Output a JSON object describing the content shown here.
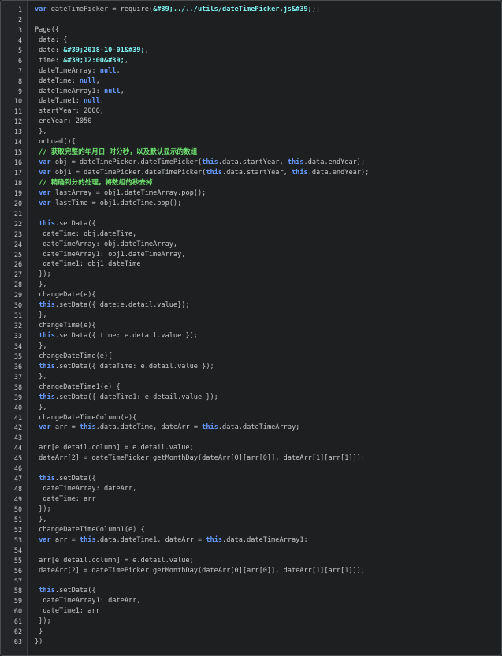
{
  "colors": {
    "background": "#1d1f21",
    "gutter": "#232528",
    "text": "#c5c8c6",
    "keyword": "#6699ff",
    "string": "#7ff2f0",
    "comment": "#6ee36e"
  },
  "lines": [
    {
      "n": "1",
      "tokens": [
        {
          "k": "kw",
          "t": "var"
        },
        {
          "k": "plain",
          "t": " dateTimePicker = require("
        },
        {
          "k": "str",
          "t": "&#39;../../utils/dateTimePicker.js&#39;"
        },
        {
          "k": "plain",
          "t": ");"
        }
      ]
    },
    {
      "n": "2",
      "tokens": []
    },
    {
      "n": "3",
      "tokens": [
        {
          "k": "plain",
          "t": "Page({"
        }
      ]
    },
    {
      "n": "4",
      "tokens": [
        {
          "k": "plain",
          "t": " data: {"
        }
      ]
    },
    {
      "n": "5",
      "tokens": [
        {
          "k": "plain",
          "t": " date: "
        },
        {
          "k": "str",
          "t": "&#39;2018-10-01&#39;"
        },
        {
          "k": "plain",
          "t": ","
        }
      ]
    },
    {
      "n": "6",
      "tokens": [
        {
          "k": "plain",
          "t": " time: "
        },
        {
          "k": "str",
          "t": "&#39;12:00&#39;"
        },
        {
          "k": "plain",
          "t": ","
        }
      ]
    },
    {
      "n": "7",
      "tokens": [
        {
          "k": "plain",
          "t": " dateTimeArray: "
        },
        {
          "k": "kw",
          "t": "null"
        },
        {
          "k": "plain",
          "t": ","
        }
      ]
    },
    {
      "n": "8",
      "tokens": [
        {
          "k": "plain",
          "t": " dateTime: "
        },
        {
          "k": "kw",
          "t": "null"
        },
        {
          "k": "plain",
          "t": ","
        }
      ]
    },
    {
      "n": "9",
      "tokens": [
        {
          "k": "plain",
          "t": " dateTimeArray1: "
        },
        {
          "k": "kw",
          "t": "null"
        },
        {
          "k": "plain",
          "t": ","
        }
      ]
    },
    {
      "n": "10",
      "tokens": [
        {
          "k": "plain",
          "t": " dateTime1: "
        },
        {
          "k": "kw",
          "t": "null"
        },
        {
          "k": "plain",
          "t": ","
        }
      ]
    },
    {
      "n": "11",
      "tokens": [
        {
          "k": "plain",
          "t": " startYear: 2000,"
        }
      ]
    },
    {
      "n": "12",
      "tokens": [
        {
          "k": "plain",
          "t": " endYear: 2050"
        }
      ]
    },
    {
      "n": "13",
      "tokens": [
        {
          "k": "plain",
          "t": " },"
        }
      ]
    },
    {
      "n": "14",
      "tokens": [
        {
          "k": "plain",
          "t": " onLoad(){"
        }
      ]
    },
    {
      "n": "15",
      "tokens": [
        {
          "k": "cmt",
          "t": " // 获取完整的年月日 时分秒，以及默认显示的数组"
        }
      ]
    },
    {
      "n": "16",
      "tokens": [
        {
          "k": "plain",
          "t": " "
        },
        {
          "k": "kw",
          "t": "var"
        },
        {
          "k": "plain",
          "t": " obj = dateTimePicker.dateTimePicker("
        },
        {
          "k": "kw",
          "t": "this"
        },
        {
          "k": "plain",
          "t": ".data.startYear, "
        },
        {
          "k": "kw",
          "t": "this"
        },
        {
          "k": "plain",
          "t": ".data.endYear);"
        }
      ]
    },
    {
      "n": "17",
      "tokens": [
        {
          "k": "plain",
          "t": " "
        },
        {
          "k": "kw",
          "t": "var"
        },
        {
          "k": "plain",
          "t": " obj1 = dateTimePicker.dateTimePicker("
        },
        {
          "k": "kw",
          "t": "this"
        },
        {
          "k": "plain",
          "t": ".data.startYear, "
        },
        {
          "k": "kw",
          "t": "this"
        },
        {
          "k": "plain",
          "t": ".data.endYear);"
        }
      ]
    },
    {
      "n": "18",
      "tokens": [
        {
          "k": "cmt",
          "t": " // 精确到分的处理，将数组的秒去掉"
        }
      ]
    },
    {
      "n": "19",
      "tokens": [
        {
          "k": "plain",
          "t": " "
        },
        {
          "k": "kw",
          "t": "var"
        },
        {
          "k": "plain",
          "t": " lastArray = obj1.dateTimeArray.pop();"
        }
      ]
    },
    {
      "n": "20",
      "tokens": [
        {
          "k": "plain",
          "t": " "
        },
        {
          "k": "kw",
          "t": "var"
        },
        {
          "k": "plain",
          "t": " lastTime = obj1.dateTime.pop();"
        }
      ]
    },
    {
      "n": "21",
      "tokens": []
    },
    {
      "n": "22",
      "tokens": [
        {
          "k": "plain",
          "t": " "
        },
        {
          "k": "kw",
          "t": "this"
        },
        {
          "k": "plain",
          "t": ".setData({"
        }
      ]
    },
    {
      "n": "23",
      "tokens": [
        {
          "k": "plain",
          "t": "  dateTime: obj.dateTime,"
        }
      ]
    },
    {
      "n": "24",
      "tokens": [
        {
          "k": "plain",
          "t": "  dateTimeArray: obj.dateTimeArray,"
        }
      ]
    },
    {
      "n": "25",
      "tokens": [
        {
          "k": "plain",
          "t": "  dateTimeArray1: obj1.dateTimeArray,"
        }
      ]
    },
    {
      "n": "26",
      "tokens": [
        {
          "k": "plain",
          "t": "  dateTime1: obj1.dateTime"
        }
      ]
    },
    {
      "n": "27",
      "tokens": [
        {
          "k": "plain",
          "t": " });"
        }
      ]
    },
    {
      "n": "28",
      "tokens": [
        {
          "k": "plain",
          "t": " },"
        }
      ]
    },
    {
      "n": "29",
      "tokens": [
        {
          "k": "plain",
          "t": " changeDate(e){"
        }
      ]
    },
    {
      "n": "30",
      "tokens": [
        {
          "k": "plain",
          "t": " "
        },
        {
          "k": "kw",
          "t": "this"
        },
        {
          "k": "plain",
          "t": ".setData({ date:e.detail.value});"
        }
      ]
    },
    {
      "n": "31",
      "tokens": [
        {
          "k": "plain",
          "t": " },"
        }
      ]
    },
    {
      "n": "32",
      "tokens": [
        {
          "k": "plain",
          "t": " changeTime(e){"
        }
      ]
    },
    {
      "n": "33",
      "tokens": [
        {
          "k": "plain",
          "t": " "
        },
        {
          "k": "kw",
          "t": "this"
        },
        {
          "k": "plain",
          "t": ".setData({ time: e.detail.value });"
        }
      ]
    },
    {
      "n": "34",
      "tokens": [
        {
          "k": "plain",
          "t": " },"
        }
      ]
    },
    {
      "n": "35",
      "tokens": [
        {
          "k": "plain",
          "t": " changeDateTime(e){"
        }
      ]
    },
    {
      "n": "36",
      "tokens": [
        {
          "k": "plain",
          "t": " "
        },
        {
          "k": "kw",
          "t": "this"
        },
        {
          "k": "plain",
          "t": ".setData({ dateTime: e.detail.value });"
        }
      ]
    },
    {
      "n": "37",
      "tokens": [
        {
          "k": "plain",
          "t": " },"
        }
      ]
    },
    {
      "n": "38",
      "tokens": [
        {
          "k": "plain",
          "t": " changeDateTime1(e) {"
        }
      ]
    },
    {
      "n": "39",
      "tokens": [
        {
          "k": "plain",
          "t": " "
        },
        {
          "k": "kw",
          "t": "this"
        },
        {
          "k": "plain",
          "t": ".setData({ dateTime1: e.detail.value });"
        }
      ]
    },
    {
      "n": "40",
      "tokens": [
        {
          "k": "plain",
          "t": " },"
        }
      ]
    },
    {
      "n": "41",
      "tokens": [
        {
          "k": "plain",
          "t": " changeDateTimeColumn(e){"
        }
      ]
    },
    {
      "n": "42",
      "tokens": [
        {
          "k": "plain",
          "t": " "
        },
        {
          "k": "kw",
          "t": "var"
        },
        {
          "k": "plain",
          "t": " arr = "
        },
        {
          "k": "kw",
          "t": "this"
        },
        {
          "k": "plain",
          "t": ".data.dateTime, dateArr = "
        },
        {
          "k": "kw",
          "t": "this"
        },
        {
          "k": "plain",
          "t": ".data.dateTimeArray;"
        }
      ]
    },
    {
      "n": "43",
      "tokens": []
    },
    {
      "n": "44",
      "tokens": [
        {
          "k": "plain",
          "t": " arr[e.detail.column] = e.detail.value;"
        }
      ]
    },
    {
      "n": "45",
      "tokens": [
        {
          "k": "plain",
          "t": " dateArr[2] = dateTimePicker.getMonthDay(dateArr[0][arr[0]], dateArr[1][arr[1]]);"
        }
      ]
    },
    {
      "n": "46",
      "tokens": []
    },
    {
      "n": "47",
      "tokens": [
        {
          "k": "plain",
          "t": " "
        },
        {
          "k": "kw",
          "t": "this"
        },
        {
          "k": "plain",
          "t": ".setData({"
        }
      ]
    },
    {
      "n": "48",
      "tokens": [
        {
          "k": "plain",
          "t": "  dateTimeArray: dateArr,"
        }
      ]
    },
    {
      "n": "49",
      "tokens": [
        {
          "k": "plain",
          "t": "  dateTime: arr"
        }
      ]
    },
    {
      "n": "50",
      "tokens": [
        {
          "k": "plain",
          "t": " });"
        }
      ]
    },
    {
      "n": "51",
      "tokens": [
        {
          "k": "plain",
          "t": " },"
        }
      ]
    },
    {
      "n": "52",
      "tokens": [
        {
          "k": "plain",
          "t": " changeDateTimeColumn1(e) {"
        }
      ]
    },
    {
      "n": "53",
      "tokens": [
        {
          "k": "plain",
          "t": " "
        },
        {
          "k": "kw",
          "t": "var"
        },
        {
          "k": "plain",
          "t": " arr = "
        },
        {
          "k": "kw",
          "t": "this"
        },
        {
          "k": "plain",
          "t": ".data.dateTime1, dateArr = "
        },
        {
          "k": "kw",
          "t": "this"
        },
        {
          "k": "plain",
          "t": ".data.dateTimeArray1;"
        }
      ]
    },
    {
      "n": "54",
      "tokens": []
    },
    {
      "n": "55",
      "tokens": [
        {
          "k": "plain",
          "t": " arr[e.detail.column] = e.detail.value;"
        }
      ]
    },
    {
      "n": "56",
      "tokens": [
        {
          "k": "plain",
          "t": " dateArr[2] = dateTimePicker.getMonthDay(dateArr[0][arr[0]], dateArr[1][arr[1]]);"
        }
      ]
    },
    {
      "n": "57",
      "tokens": []
    },
    {
      "n": "58",
      "tokens": [
        {
          "k": "plain",
          "t": " "
        },
        {
          "k": "kw",
          "t": "this"
        },
        {
          "k": "plain",
          "t": ".setData({"
        }
      ]
    },
    {
      "n": "59",
      "tokens": [
        {
          "k": "plain",
          "t": "  dateTimeArray1: dateArr,"
        }
      ]
    },
    {
      "n": "60",
      "tokens": [
        {
          "k": "plain",
          "t": "  dateTime1: arr"
        }
      ]
    },
    {
      "n": "61",
      "tokens": [
        {
          "k": "plain",
          "t": " });"
        }
      ]
    },
    {
      "n": "62",
      "tokens": [
        {
          "k": "plain",
          "t": " }"
        }
      ]
    },
    {
      "n": "63",
      "tokens": [
        {
          "k": "plain",
          "t": "})"
        }
      ]
    }
  ]
}
